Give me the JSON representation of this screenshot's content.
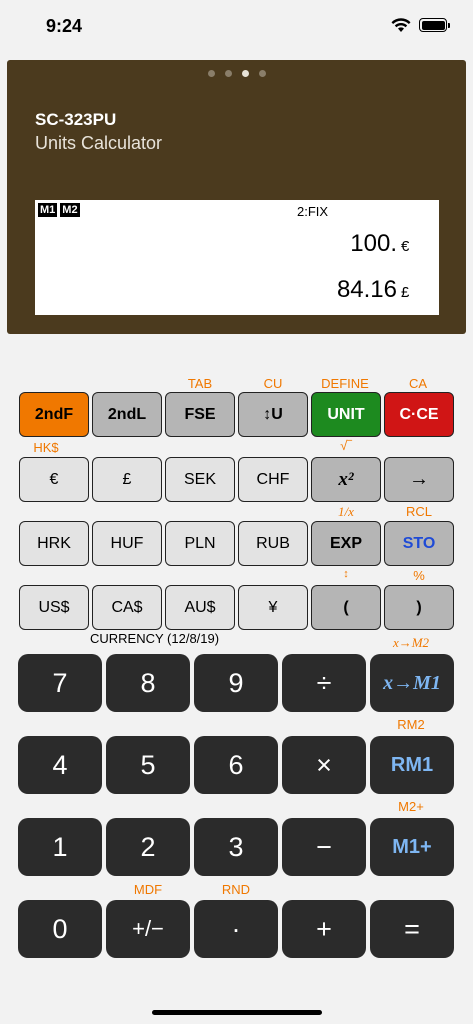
{
  "status": {
    "time": "9:24"
  },
  "header": {
    "model": "SC-323PU",
    "subtitle": "Units Calculator",
    "page_dots": 4,
    "active_dot": 3
  },
  "display": {
    "mem1": "M1",
    "mem2": "M2",
    "mode": "2:FIX",
    "top_value": "100.",
    "top_unit": "€",
    "bottom_value": "84.16",
    "bottom_unit": "£"
  },
  "row_labels": {
    "fse_alt": "TAB",
    "u_alt": "CU",
    "unit_alt": "DEFINE",
    "cce_alt": "CA",
    "euro_alt": "HK$",
    "x2_alt": "√‾",
    "exp_alt": "1/x",
    "sto_alt": "RCL",
    "paren_open_alt": "↕",
    "paren_close_alt": "%",
    "xm1_alt": "x→M2",
    "rm1_alt": "RM2",
    "mplus_alt": "M2+",
    "plusminus_alt": "MDF",
    "dot_alt": "RND"
  },
  "keys": {
    "row1": [
      "2ndF",
      "2ndL",
      "FSE",
      "↕U",
      "UNIT",
      "C·CE"
    ],
    "row2": [
      "€",
      "£",
      "SEK",
      "CHF",
      "x²",
      "→"
    ],
    "row3": [
      "HRK",
      "HUF",
      "PLN",
      "RUB",
      "EXP",
      "STO"
    ],
    "row4": [
      "US$",
      "CA$",
      "AU$",
      "¥",
      "(",
      ")"
    ]
  },
  "currency_note": "CURRENCY (12/8/19)",
  "numpad": {
    "row1": [
      "7",
      "8",
      "9",
      "÷",
      "x→M1"
    ],
    "row2": [
      "4",
      "5",
      "6",
      "×",
      "RM1"
    ],
    "row3": [
      "1",
      "2",
      "3",
      "−",
      "M1+"
    ],
    "row4": [
      "0",
      "+/−",
      "·",
      "+",
      "="
    ]
  },
  "colors": {
    "panel": "#4b3a1e",
    "orange": "#f07800",
    "green": "#1d8a1f",
    "red": "#d01515",
    "blue": "#7eb6f2"
  }
}
